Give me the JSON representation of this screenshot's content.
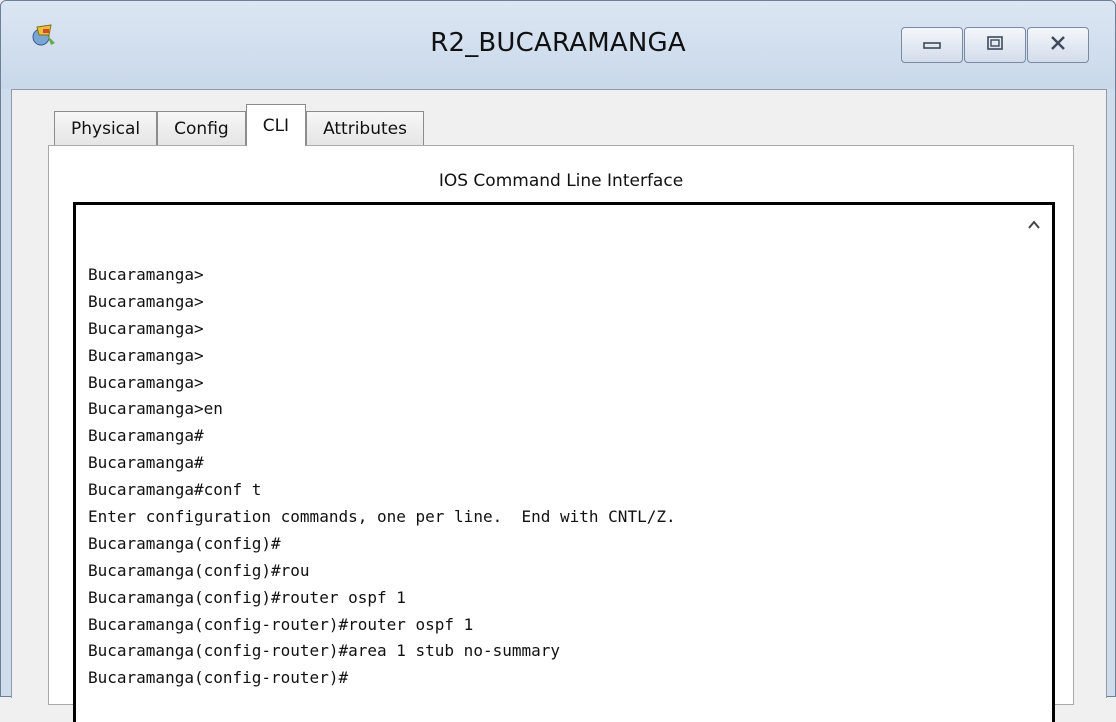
{
  "window": {
    "title": "R2_BUCARAMANGA",
    "icon": "packet-tracer-router-icon",
    "controls": [
      "minimize-icon",
      "maximize-icon",
      "close-icon"
    ]
  },
  "tabs": [
    {
      "label": "Physical",
      "active": false
    },
    {
      "label": "Config",
      "active": false
    },
    {
      "label": "CLI",
      "active": true
    },
    {
      "label": "Attributes",
      "active": false
    }
  ],
  "cli": {
    "heading": "IOS Command Line Interface",
    "lines": [
      "Bucaramanga>",
      "Bucaramanga>",
      "Bucaramanga>",
      "Bucaramanga>",
      "Bucaramanga>",
      "Bucaramanga>en",
      "Bucaramanga#",
      "Bucaramanga#",
      "Bucaramanga#conf t",
      "Enter configuration commands, one per line.  End with CNTL/Z.",
      "Bucaramanga(config)#",
      "Bucaramanga(config)#rou",
      "Bucaramanga(config)#router ospf 1",
      "Bucaramanga(config-router)#router ospf 1",
      "Bucaramanga(config-router)#area 1 stub no-summary",
      "Bucaramanga(config-router)#"
    ]
  }
}
